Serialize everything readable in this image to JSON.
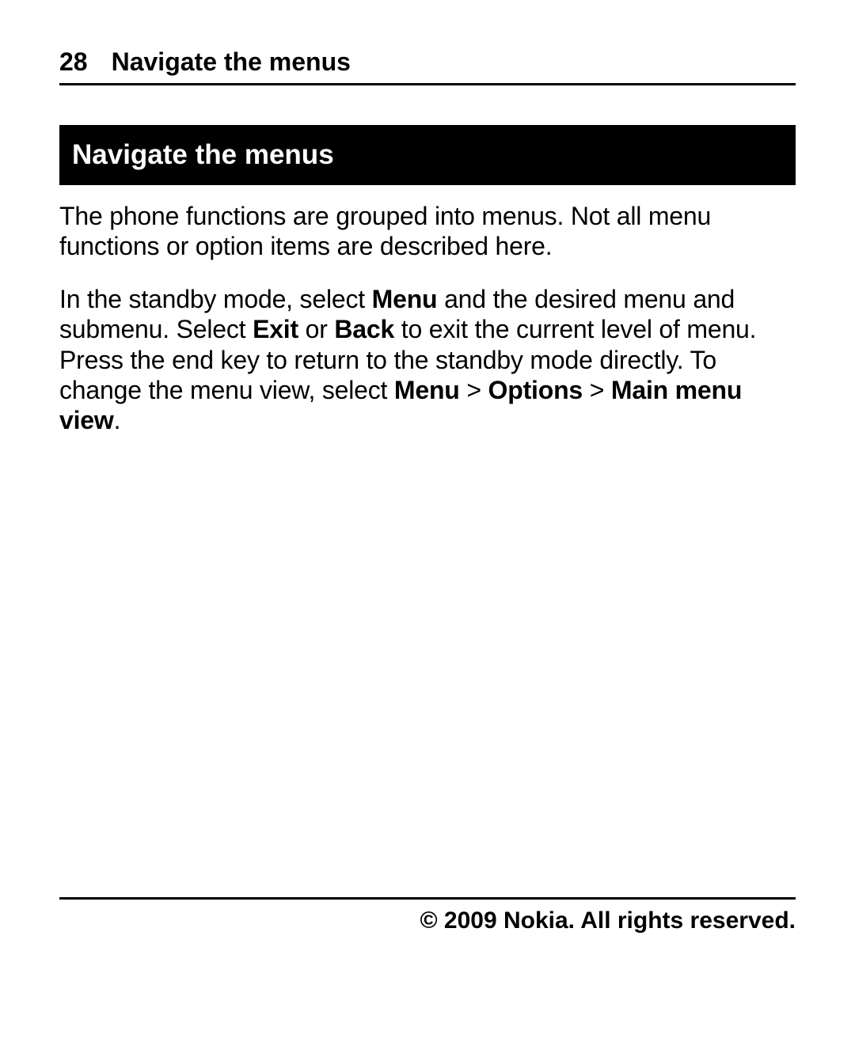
{
  "header": {
    "page_number": "28",
    "running_title": "Navigate the menus"
  },
  "section": {
    "title": "Navigate the menus"
  },
  "para1": "The phone functions are grouped into menus. Not all menu functions or option items are described here.",
  "para2": {
    "t1": "In the standby mode, select ",
    "b1": "Menu",
    "t2": " and the desired menu and submenu. Select ",
    "b2": "Exit",
    "t3": " or ",
    "b3": "Back",
    "t4": " to exit the current level of menu. Press the end key to return to the standby mode directly. To change the menu view, select ",
    "b4": "Menu",
    "t5": " > ",
    "b5": "Options",
    "t6": " > ",
    "b6": "Main menu view",
    "t7": "."
  },
  "footer": {
    "copyright": "© 2009 Nokia. All rights reserved."
  }
}
